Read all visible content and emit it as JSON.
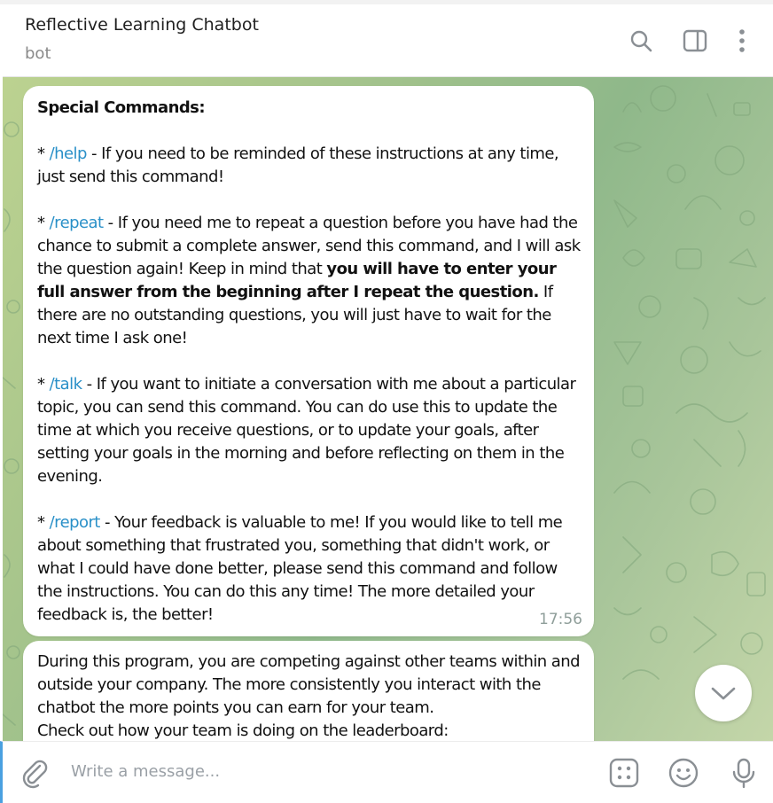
{
  "header": {
    "title": "Reflective Learning Chatbot",
    "subtitle": "bot",
    "icons": [
      "search-icon",
      "sidebar-toggle-icon",
      "more-vertical-icon"
    ]
  },
  "messages": [
    {
      "heading": "Special Commands:",
      "commands": [
        {
          "bullet": "*",
          "command": "/help",
          "text": " - If you need to be reminded of these instructions at any time, just send this command!"
        },
        {
          "bullet": "*",
          "command": "/repeat",
          "text_before": " - If you need me to repeat a question before you have had the chance to submit a complete answer, send this command, and I will ask the question again! Keep in mind that ",
          "bold": "you will have to enter your full answer from the beginning after I repeat the question.",
          "text_after": " If there are no outstanding questions, you will just have to wait for the next time I ask one!"
        },
        {
          "bullet": "*",
          "command": "/talk",
          "text": " - If you want to initiate a conversation with me about a particular topic, you can send this command. You can do use this to update the time at which you receive questions, or to update your goals, after setting your goals in the morning and before reflecting on them in the evening."
        },
        {
          "bullet": "*",
          "command": "/report",
          "text": " - Your feedback is valuable to me! If you would like to tell me about something that frustrated you, something that didn't work, or what I could have done better, please send this command and follow the instructions. You can do this any time! The more detailed your feedback is, the better!"
        }
      ],
      "time": "17:56"
    },
    {
      "lines": [
        "During this program, you are competing against other teams within and outside your company. The more consistently you interact with the chatbot the more points you can earn for your team.",
        "Check out how your team is doing on the leaderboard:"
      ]
    }
  ],
  "composer": {
    "placeholder": "Write a message...",
    "icons": [
      "attach-icon",
      "bot-commands-icon",
      "emoji-icon",
      "microphone-icon"
    ]
  },
  "scroll_button": {
    "icon": "chevron-down-icon"
  }
}
